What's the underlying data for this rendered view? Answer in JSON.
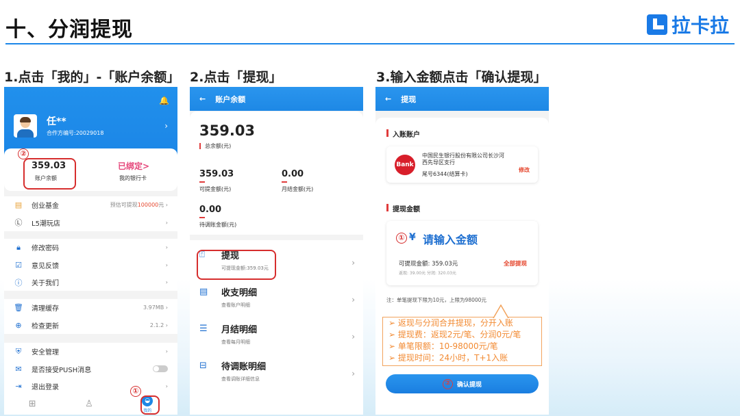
{
  "slide": {
    "title": "十、分润提现",
    "brand": "拉卡拉",
    "steps": [
      "1.点击「我的」-「账户余额」",
      "2.点击「提现」",
      "3.输入金额点击「确认提现」"
    ]
  },
  "phone1": {
    "user_name": "任**",
    "user_id": "合作方编号:20029018",
    "balance_value": "359.03",
    "balance_label": "账户余额",
    "bound_value": "已绑定>",
    "bound_label": "我的银行卡",
    "marker_1": "①",
    "marker_2": "②",
    "items": [
      {
        "icon": "coins-icon",
        "label": "创业基金",
        "right_prefix": "预估可提现",
        "right_highlight": "100000",
        "right_suffix": "元"
      },
      {
        "icon": "l5-icon",
        "label": "L5潮玩店",
        "right": ""
      },
      {
        "icon": "lock-icon",
        "label": "修改密码",
        "right": ""
      },
      {
        "icon": "feedback-icon",
        "label": "意见反馈",
        "right": ""
      },
      {
        "icon": "about-icon",
        "label": "关于我们",
        "right": ""
      },
      {
        "icon": "trash-icon",
        "label": "清理缓存",
        "right": "3.97MB"
      },
      {
        "icon": "update-icon",
        "label": "检查更新",
        "right": "2.1.2"
      },
      {
        "icon": "shield-icon",
        "label": "安全管理",
        "right": ""
      },
      {
        "icon": "mail-icon",
        "label": "是否接受PUSH消息",
        "right": ""
      },
      {
        "icon": "logout-icon",
        "label": "退出登录",
        "right": ""
      }
    ],
    "tabs": [
      "",
      "",
      "我的"
    ]
  },
  "phone2": {
    "header": "账户余额",
    "total_value": "359.03",
    "total_label": "总余额(元)",
    "withdrawable_value": "359.03",
    "withdrawable_label": "可提金额(元)",
    "monthly_value": "0.00",
    "monthly_label": "月结金额(元)",
    "pending_value": "0.00",
    "pending_label": "待调账金额(元)",
    "ops": [
      {
        "title": "提现",
        "sub": "可提现金额:359.03元"
      },
      {
        "title": "收支明细",
        "sub": "查看账户明细"
      },
      {
        "title": "月结明细",
        "sub": "查看每月明细"
      },
      {
        "title": "待调账明细",
        "sub": "查看调账详细信息"
      }
    ]
  },
  "phone3": {
    "header": "提现",
    "section_account": "入账账户",
    "bank_logo": "Bank",
    "bank_name": "中国民生银行股份有限公司长沙河西先导区支行",
    "bank_tail": "尾号6344(结算卡)",
    "edit": "修改",
    "section_amount": "提现金额",
    "marker_1": "①",
    "yen": "¥",
    "amount_placeholder": "请输入金额",
    "available": "可提现金额: 359.03元",
    "withdraw_all": "全部提现",
    "sub_amounts": "返现: 39.00元    分润: 320.03元",
    "note": "注：单笔提现下限为10元，上限为98000元",
    "tips": [
      "➢ 返现与分润合并提现，分开入账",
      "➢ 提现费：返现2元/笔、分润0元/笔",
      "➢ 单笔限额：10-98000元/笔",
      "➢ 提现时间：24小时，T+1入账"
    ],
    "marker_2": "②",
    "confirm": "确认提现"
  }
}
